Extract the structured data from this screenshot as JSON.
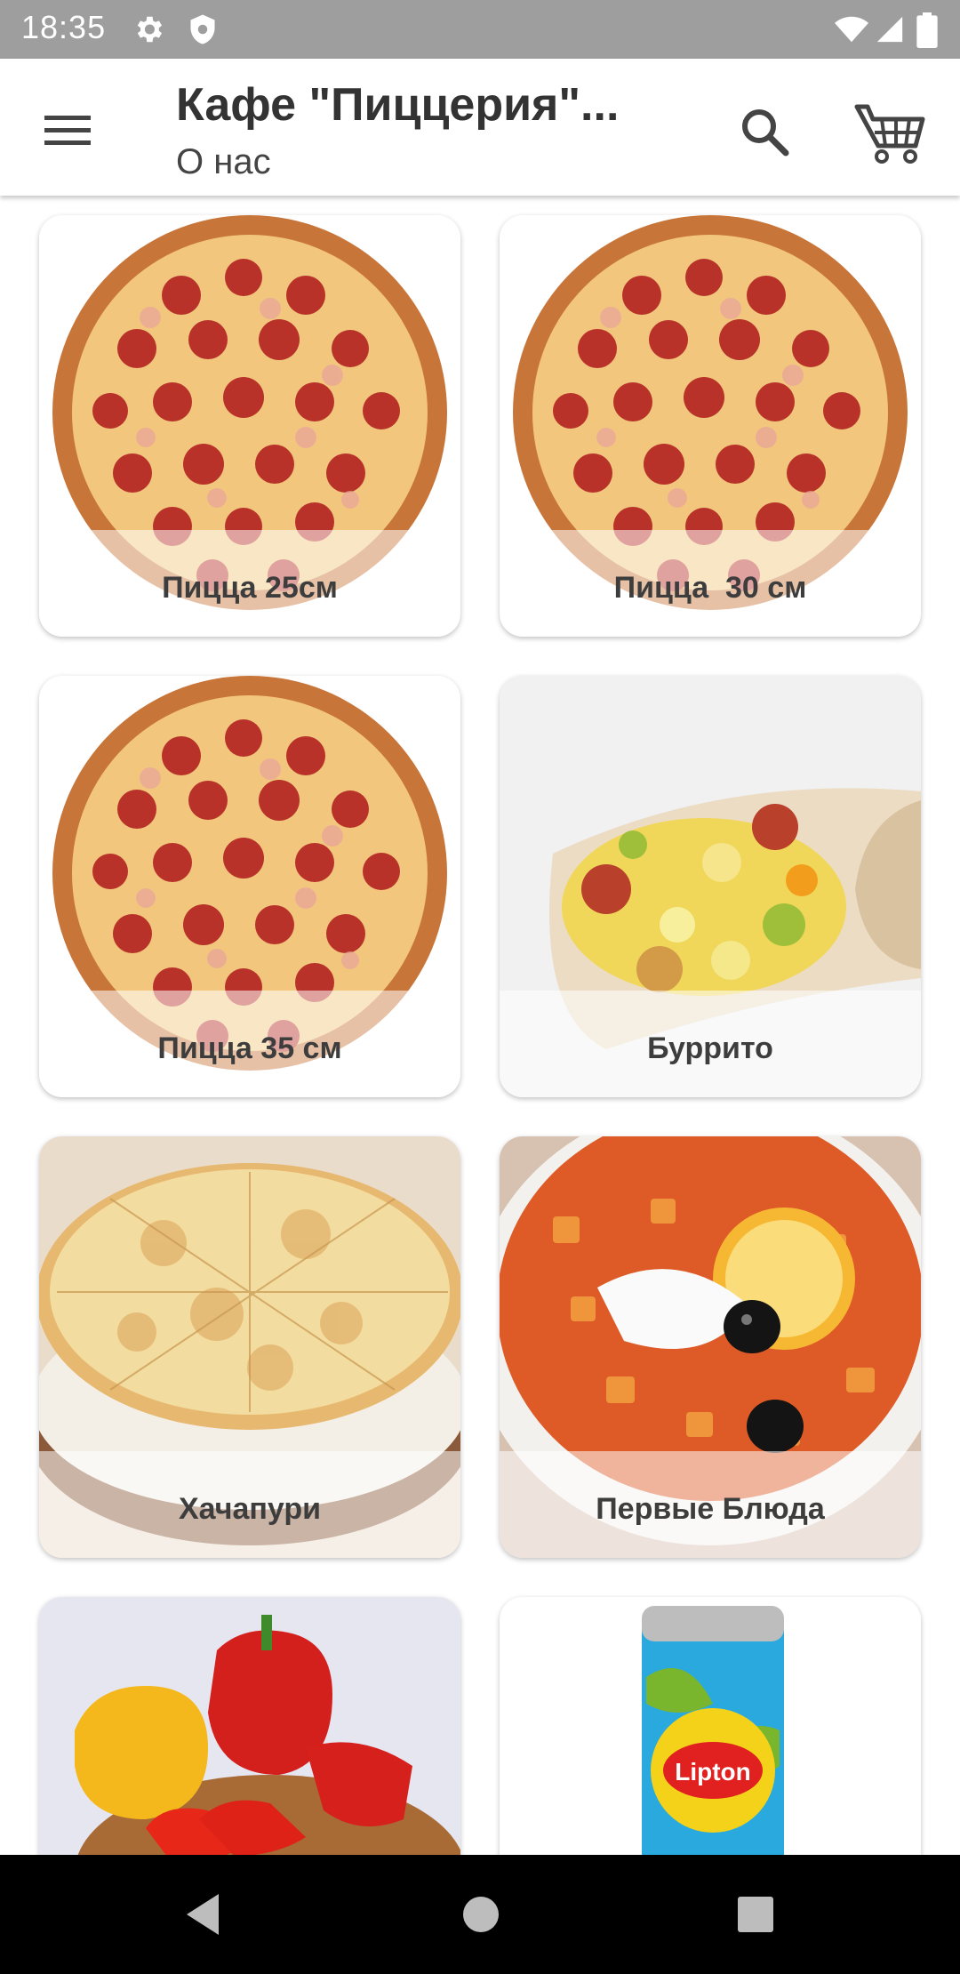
{
  "status_bar": {
    "time": "18:35",
    "icons": [
      "gear-icon",
      "shield-icon",
      "wifi-icon",
      "signal-icon",
      "battery-icon"
    ]
  },
  "app_bar": {
    "title": "Кафе \"Пиццерия\"...",
    "subtitle": "О нас",
    "icons": [
      "menu-icon",
      "search-icon",
      "cart-icon"
    ]
  },
  "categories": [
    {
      "label": "Пицца 25см",
      "image": "pizza"
    },
    {
      "label": "Пицца  30 см",
      "image": "pizza"
    },
    {
      "label": "Пицца 35 см",
      "image": "pizza"
    },
    {
      "label": "Буррито",
      "image": "burrito"
    },
    {
      "label": "Хачапури",
      "image": "khachapuri"
    },
    {
      "label": "Первые Блюда",
      "image": "soup"
    },
    {
      "label": "",
      "image": "peppers"
    },
    {
      "label": "",
      "image": "lipton-can",
      "brand_text": "Lipton"
    }
  ],
  "nav_bar": {
    "icons": [
      "back-icon",
      "home-icon",
      "recents-icon"
    ]
  }
}
